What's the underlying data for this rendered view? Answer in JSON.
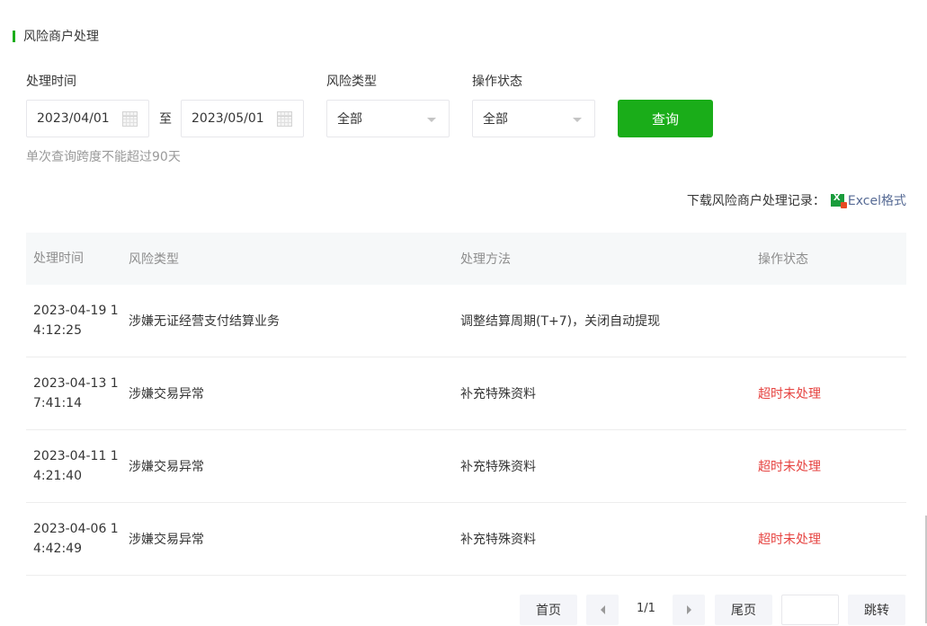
{
  "section": {
    "title": "风险商户处理"
  },
  "filters": {
    "time_label": "处理时间",
    "start_date": "2023/04/01",
    "to_text": "至",
    "end_date": "2023/05/01",
    "risk_type_label": "风险类型",
    "risk_type_value": "全部",
    "op_status_label": "操作状态",
    "op_status_value": "全部",
    "query_label": "查询",
    "hint": "单次查询跨度不能超过90天"
  },
  "download": {
    "label": "下载风险商户处理记录：",
    "link_text": "Excel格式"
  },
  "table": {
    "headers": [
      "处理时间",
      "风险类型",
      "处理方法",
      "操作状态"
    ],
    "rows": [
      {
        "time": "2023-04-19 14:12:25",
        "type": "涉嫌无证经营支付结算业务",
        "method": "调整结算周期(T+7)，关闭自动提现",
        "status": ""
      },
      {
        "time": "2023-04-13 17:41:14",
        "type": "涉嫌交易异常",
        "method": "补充特殊资料",
        "status": "超时未处理"
      },
      {
        "time": "2023-04-11 14:21:40",
        "type": "涉嫌交易异常",
        "method": "补充特殊资料",
        "status": "超时未处理"
      },
      {
        "time": "2023-04-06 14:42:49",
        "type": "涉嫌交易异常",
        "method": "补充特殊资料",
        "status": "超时未处理"
      }
    ]
  },
  "pagination": {
    "first": "首页",
    "page_info": "1/1",
    "last": "尾页",
    "jump_input": "",
    "jump": "跳转"
  },
  "colors": {
    "accent": "#1aad19",
    "status_red": "#e64340",
    "link": "#576b95"
  }
}
